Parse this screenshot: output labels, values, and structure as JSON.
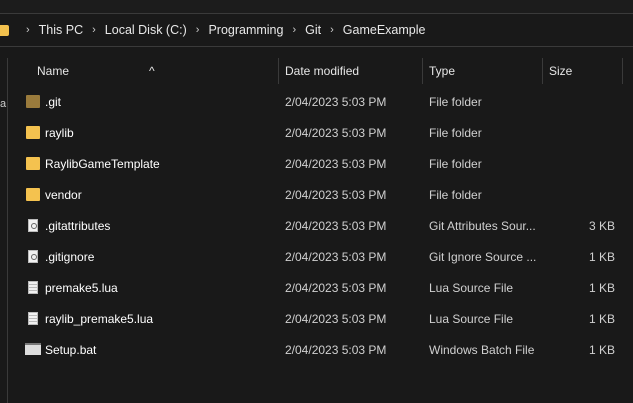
{
  "breadcrumb": [
    "This PC",
    "Local Disk (C:)",
    "Programming",
    "Git",
    "GameExample"
  ],
  "columns": {
    "name": "Name",
    "date": "Date modified",
    "type": "Type",
    "size": "Size"
  },
  "side_fragment": "a",
  "files": [
    {
      "name": ".git",
      "date": "2/04/2023 5:03 PM",
      "type": "File folder",
      "size": "",
      "icon": "folder-git"
    },
    {
      "name": "raylib",
      "date": "2/04/2023 5:03 PM",
      "type": "File folder",
      "size": "",
      "icon": "folder"
    },
    {
      "name": "RaylibGameTemplate",
      "date": "2/04/2023 5:03 PM",
      "type": "File folder",
      "size": "",
      "icon": "folder"
    },
    {
      "name": "vendor",
      "date": "2/04/2023 5:03 PM",
      "type": "File folder",
      "size": "",
      "icon": "folder"
    },
    {
      "name": ".gitattributes",
      "date": "2/04/2023 5:03 PM",
      "type": "Git Attributes Sour...",
      "size": "3 KB",
      "icon": "settings-file"
    },
    {
      "name": ".gitignore",
      "date": "2/04/2023 5:03 PM",
      "type": "Git Ignore Source ...",
      "size": "1 KB",
      "icon": "settings-file"
    },
    {
      "name": "premake5.lua",
      "date": "2/04/2023 5:03 PM",
      "type": "Lua Source File",
      "size": "1 KB",
      "icon": "text-file"
    },
    {
      "name": "raylib_premake5.lua",
      "date": "2/04/2023 5:03 PM",
      "type": "Lua Source File",
      "size": "1 KB",
      "icon": "text-file"
    },
    {
      "name": "Setup.bat",
      "date": "2/04/2023 5:03 PM",
      "type": "Windows Batch File",
      "size": "1 KB",
      "icon": "batch-file"
    }
  ]
}
